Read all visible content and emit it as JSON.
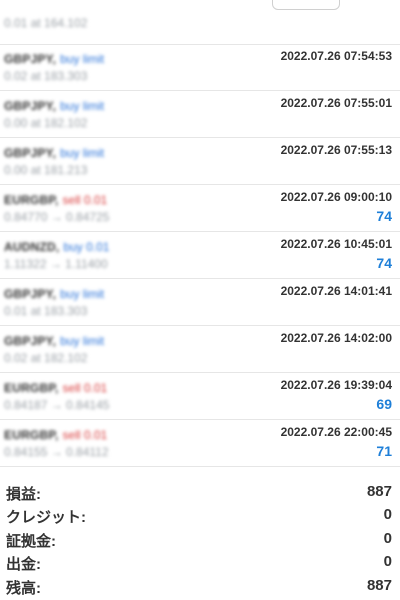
{
  "top_partial": {
    "detail": "0.01 at 164.102"
  },
  "trades": [
    {
      "symbol": "GBPJPY,",
      "type": "buy limit",
      "type_color": "buy",
      "detail": "0.02 at 183.303",
      "time": "2022.07.26 07:54:53",
      "profit": ""
    },
    {
      "symbol": "GBPJPY,",
      "type": "buy limit",
      "type_color": "buy",
      "detail": "0.00 at 182.102",
      "time": "2022.07.26 07:55:01",
      "profit": ""
    },
    {
      "symbol": "GBPJPY,",
      "type": "buy limit",
      "type_color": "buy",
      "detail": "0.00 at 181.213",
      "time": "2022.07.26 07:55:13",
      "profit": ""
    },
    {
      "symbol": "EURGBP,",
      "type": "sell 0.01",
      "type_color": "sell",
      "detail": "0.84770 → 0.84725",
      "time": "2022.07.26 09:00:10",
      "profit": "74"
    },
    {
      "symbol": "AUDNZD,",
      "type": "buy 0.01",
      "type_color": "buy",
      "detail": "1.11322 → 1.11400",
      "time": "2022.07.26 10:45:01",
      "profit": "74"
    },
    {
      "symbol": "GBPJPY,",
      "type": "buy limit",
      "type_color": "buy",
      "detail": "0.01 at 183.303",
      "time": "2022.07.26 14:01:41",
      "profit": ""
    },
    {
      "symbol": "GBPJPY,",
      "type": "buy limit",
      "type_color": "buy",
      "detail": "0.02 at 182.102",
      "time": "2022.07.26 14:02:00",
      "profit": ""
    },
    {
      "symbol": "EURGBP,",
      "type": "sell 0.01",
      "type_color": "sell",
      "detail": "0.84187 → 0.84145",
      "time": "2022.07.26 19:39:04",
      "profit": "69"
    },
    {
      "symbol": "EURGBP,",
      "type": "sell 0.01",
      "type_color": "sell",
      "detail": "0.84155 → 0.84112",
      "time": "2022.07.26 22:00:45",
      "profit": "71"
    }
  ],
  "summary": [
    {
      "label": "損益:",
      "value": "887"
    },
    {
      "label": "クレジット:",
      "value": "0"
    },
    {
      "label": "証拠金:",
      "value": "0"
    },
    {
      "label": "出金:",
      "value": "0"
    },
    {
      "label": "残高:",
      "value": "887"
    }
  ],
  "colors": {
    "profit": "#1e7fd8",
    "buy": "#2a73d9",
    "sell": "#d83a3a",
    "divider": "#e6e6e6"
  }
}
